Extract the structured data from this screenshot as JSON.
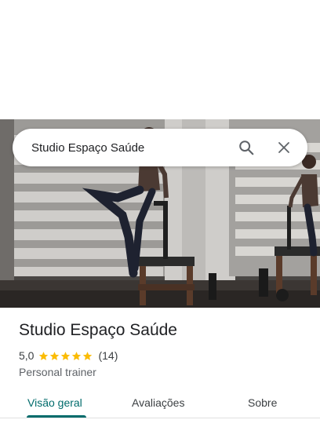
{
  "search": {
    "query": "Studio Espaço Saúde",
    "search_icon": "search-icon",
    "close_icon": "close-icon"
  },
  "place": {
    "name": "Studio Espaço Saúde",
    "rating": "5,0",
    "rating_value": 5,
    "review_count": "(14)",
    "category": "Personal trainer"
  },
  "tabs": [
    {
      "label": "Visão geral",
      "active": true
    },
    {
      "label": "Avaliações",
      "active": false
    },
    {
      "label": "Sobre",
      "active": false
    }
  ],
  "colors": {
    "accent": "#006b6b",
    "star": "#fbbc04"
  }
}
